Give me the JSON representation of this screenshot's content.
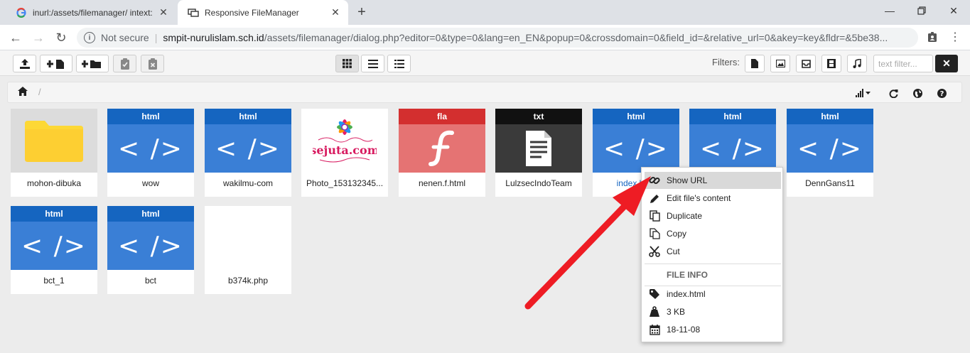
{
  "browser": {
    "tabs": [
      {
        "title": "inurl:/assets/filemanager/ intext:",
        "favicon": "google-g-icon",
        "active": false
      },
      {
        "title": "Responsive FileManager",
        "favicon": "filemanager-icon",
        "active": true
      }
    ],
    "address": {
      "security": "Not secure",
      "host": "smpit-nurulislam.sch.id",
      "path": "/assets/filemanager/dialog.php?editor=0&type=0&lang=en_EN&popup=0&crossdomain=0&field_id=&relative_url=0&akey=key&fldr=&5be38..."
    }
  },
  "toolbar": {
    "filters_label": "Filters:",
    "text_filter_placeholder": "text filter..."
  },
  "breadcrumb": {
    "separator": "/"
  },
  "files": [
    {
      "name": "mohon-dibuka",
      "type": "folder",
      "ext": ""
    },
    {
      "name": "wow",
      "type": "code",
      "ext": "html"
    },
    {
      "name": "wakilmu-com",
      "type": "code",
      "ext": "html"
    },
    {
      "name": "Photo_153132345...",
      "type": "image",
      "ext": "",
      "image_text": "sejuta.com"
    },
    {
      "name": "nenen.f.html",
      "type": "flash",
      "ext": "fla"
    },
    {
      "name": "LulzsecIndoTeam",
      "type": "text",
      "ext": "txt"
    },
    {
      "name": "index.html",
      "type": "code",
      "ext": "html"
    },
    {
      "name": "",
      "type": "code",
      "ext": "html"
    },
    {
      "name": "DennGans11",
      "type": "code",
      "ext": "html"
    },
    {
      "name": "bct_1",
      "type": "code",
      "ext": "html"
    },
    {
      "name": "bct",
      "type": "code",
      "ext": "html"
    },
    {
      "name": "b374k.php",
      "type": "blank",
      "ext": ""
    }
  ],
  "context_menu": {
    "items": [
      {
        "label": "Show URL",
        "icon": "link-icon"
      },
      {
        "label": "Edit file's content",
        "icon": "pencil-icon"
      },
      {
        "label": "Duplicate",
        "icon": "duplicate-icon"
      },
      {
        "label": "Copy",
        "icon": "copy-icon"
      },
      {
        "label": "Cut",
        "icon": "scissors-icon"
      }
    ],
    "info_header": "FILE INFO",
    "info": [
      {
        "label": "index.html",
        "icon": "tag-icon"
      },
      {
        "label": "3 KB",
        "icon": "weight-icon"
      },
      {
        "label": "18-11-08",
        "icon": "calendar-icon"
      }
    ]
  },
  "colors": {
    "html_header": "#1565c0",
    "html_body": "#3a7fd6",
    "fla_header": "#d32f2f",
    "fla_body": "#e57373",
    "txt_header": "#111111",
    "txt_body": "#3a3a3a",
    "folder": "#fdd835",
    "arrow": "#ee1c24"
  }
}
